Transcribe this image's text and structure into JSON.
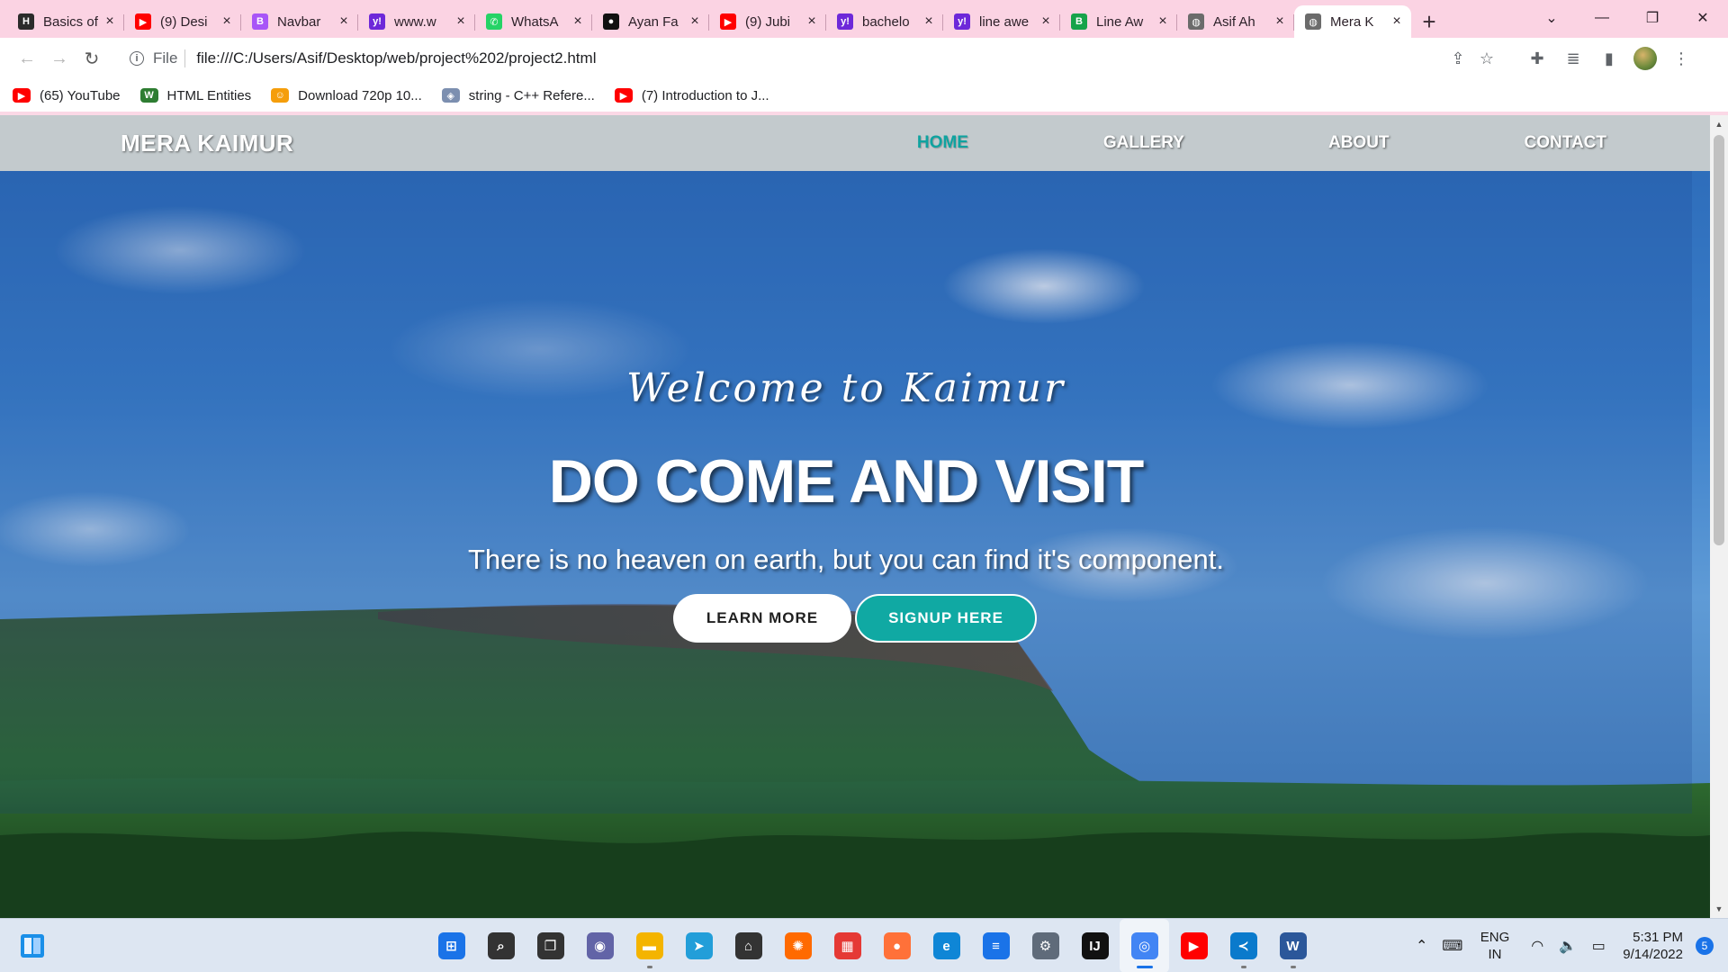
{
  "browser": {
    "tabs": [
      {
        "title": "Basics of",
        "color": "#2b2b2b",
        "glyph": "H"
      },
      {
        "title": "(9) Desi",
        "color": "#ff0000",
        "glyph": "▶"
      },
      {
        "title": "Navbar",
        "color": "#a855f7",
        "glyph": "B"
      },
      {
        "title": "www.w",
        "color": "#6d28d9",
        "glyph": "y!"
      },
      {
        "title": "WhatsA",
        "color": "#25d366",
        "glyph": "✆"
      },
      {
        "title": "Ayan Fa",
        "color": "#111111",
        "glyph": "●"
      },
      {
        "title": "(9) Jubi",
        "color": "#ff0000",
        "glyph": "▶"
      },
      {
        "title": "bachelo",
        "color": "#6d28d9",
        "glyph": "y!"
      },
      {
        "title": "line awe",
        "color": "#6d28d9",
        "glyph": "y!"
      },
      {
        "title": "Line Aw",
        "color": "#16a34a",
        "glyph": "B"
      },
      {
        "title": "Asif Ah",
        "color": "#6b6b6b",
        "glyph": "◍"
      },
      {
        "title": "Mera K",
        "color": "#6b6b6b",
        "glyph": "◍"
      }
    ],
    "active_tab_index": 11,
    "new_tab_label": "+",
    "address": {
      "scheme": "File",
      "url": "file:///C:/Users/Asif/Desktop/web/project%202/project2.html"
    },
    "bookmarks": [
      {
        "label": "(65) YouTube",
        "color": "#ff0000",
        "glyph": "▶"
      },
      {
        "label": "HTML Entities",
        "color": "#2e7d32",
        "glyph": "W"
      },
      {
        "label": "Download 720p 10...",
        "color": "#f59e0b",
        "glyph": "☺"
      },
      {
        "label": "string - C++ Refere...",
        "color": "#7c8fb0",
        "glyph": "◈"
      },
      {
        "label": "(7) Introduction to J...",
        "color": "#ff0000",
        "glyph": "▶"
      }
    ]
  },
  "site": {
    "brand": "MERA KAIMUR",
    "nav": [
      {
        "label": "HOME",
        "active": true
      },
      {
        "label": "GALLERY",
        "active": false
      },
      {
        "label": "ABOUT",
        "active": false
      },
      {
        "label": "CONTACT",
        "active": false
      }
    ],
    "hero": {
      "welcome": "Welcome to Kaimur",
      "headline": "DO COME AND VISIT",
      "tagline": "There is no heaven on earth, but you can find it's component.",
      "learn_more": "LEARN MORE",
      "signup": "SIGNUP HERE"
    },
    "accent_color": "#10a9a3"
  },
  "taskbar": {
    "apps": [
      {
        "name": "start",
        "color": "#1a73e8",
        "glyph": "⊞"
      },
      {
        "name": "search",
        "color": "#333333",
        "glyph": "⌕"
      },
      {
        "name": "task-view",
        "color": "#333333",
        "glyph": "❐"
      },
      {
        "name": "chat",
        "color": "#6264a7",
        "glyph": "◉"
      },
      {
        "name": "file-explorer",
        "color": "#f4b400",
        "glyph": "▬"
      },
      {
        "name": "telegram",
        "color": "#229ed9",
        "glyph": "➤"
      },
      {
        "name": "store",
        "color": "#333333",
        "glyph": "⌂"
      },
      {
        "name": "app-orange",
        "color": "#ff6a00",
        "glyph": "✺"
      },
      {
        "name": "app-multicolor",
        "color": "#e53935",
        "glyph": "▦"
      },
      {
        "name": "firefox",
        "color": "#ff7139",
        "glyph": "●"
      },
      {
        "name": "edge",
        "color": "#0f86d6",
        "glyph": "e"
      },
      {
        "name": "notepad",
        "color": "#1a73e8",
        "glyph": "≡"
      },
      {
        "name": "settings",
        "color": "#5f6b7a",
        "glyph": "⚙"
      },
      {
        "name": "intellij",
        "color": "#111111",
        "glyph": "IJ"
      },
      {
        "name": "chrome",
        "color": "#4285f4",
        "glyph": "◎"
      },
      {
        "name": "youtube",
        "color": "#ff0000",
        "glyph": "▶"
      },
      {
        "name": "vscode",
        "color": "#0a7acc",
        "glyph": "≺"
      },
      {
        "name": "word",
        "color": "#2b579a",
        "glyph": "W"
      }
    ],
    "language": {
      "line1": "ENG",
      "line2": "IN"
    },
    "time": "5:31 PM",
    "date": "9/14/2022",
    "notifications": "5"
  }
}
